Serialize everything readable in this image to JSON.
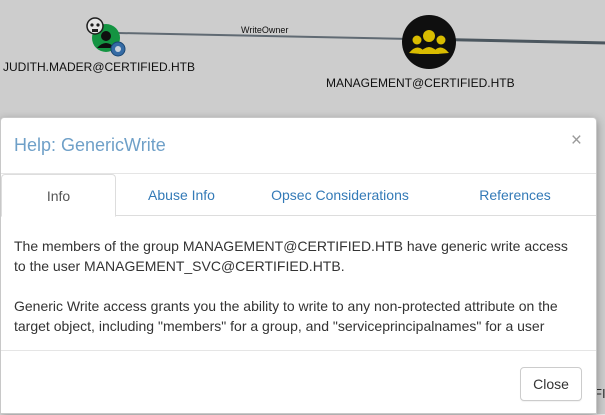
{
  "graph": {
    "edge_label": "WriteOwner",
    "source_node": {
      "label": "JUDITH.MADER@CERTIFIED.HTB",
      "icon": "user-node-icon"
    },
    "target_node": {
      "label": "MANAGEMENT@CERTIFIED.HTB",
      "icon": "group-node-icon"
    },
    "partial_label": "FI"
  },
  "modal": {
    "title": "Help: GenericWrite",
    "close_symbol": "×",
    "tabs": [
      {
        "label": "Info",
        "active": true
      },
      {
        "label": "Abuse Info",
        "active": false
      },
      {
        "label": "Opsec Considerations",
        "active": false
      },
      {
        "label": "References",
        "active": false
      }
    ],
    "paragraphs": [
      "The members of the group MANAGEMENT@CERTIFIED.HTB have generic write access to the user MANAGEMENT_SVC@CERTIFIED.HTB.",
      "Generic Write access grants you the ability to write to any non-protected attribute on the target object, including \"members\" for a group, and \"serviceprincipalnames\" for a user"
    ],
    "close_button": "Close"
  },
  "colors": {
    "title": "#6fa0c8",
    "tab_link": "#337ab7",
    "group_node": "#111111",
    "user_node_green": "#17a54a",
    "user_node_badge": "#3b78b8"
  }
}
